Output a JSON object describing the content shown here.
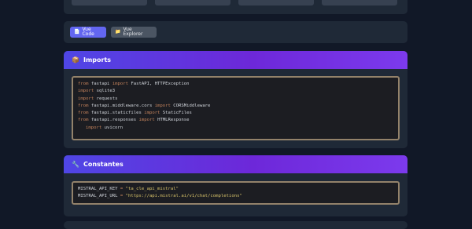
{
  "top_stubs": [
    {
      "label": ""
    },
    {
      "label": ""
    },
    {
      "label": ""
    },
    {
      "label": ""
    }
  ],
  "tabs": [
    {
      "icon": "document-icon",
      "label": "Vue Code",
      "active": true
    },
    {
      "icon": "folder-icon",
      "label": "Vue Explorer",
      "active": false
    }
  ],
  "sections": {
    "imports": {
      "icon": "package-icon",
      "title": "Imports",
      "lines": [
        {
          "kw1": "from",
          "mod": " fastapi ",
          "kw2": "import",
          "rest": " FastAPI, HTTPException"
        },
        {
          "kw1": "import",
          "mod": " sqlite3",
          "kw2": "",
          "rest": ""
        },
        {
          "kw1": "import",
          "mod": " requests",
          "kw2": "",
          "rest": ""
        },
        {
          "kw1": "from",
          "mod": " fastapi.middleware.cors ",
          "kw2": "import",
          "rest": " CORSMiddleware"
        },
        {
          "kw1": "from",
          "mod": " fastapi.staticfiles ",
          "kw2": "import",
          "rest": " StaticFiles"
        },
        {
          "kw1": "from",
          "mod": " fastapi.responses ",
          "kw2": "import",
          "rest": " HTMLResponse"
        },
        {
          "kw1": "import",
          "mod": " uvicorn",
          "kw2": "",
          "rest": ""
        }
      ]
    },
    "constants": {
      "icon": "wrench-icon",
      "title": "Constantes",
      "lines": [
        {
          "name": "MISTRAL_API_KEY ",
          "op": "=",
          "val": " \"ta_cle_api_mistral\""
        },
        {
          "name": "MISTRAL_API_URL ",
          "op": "=",
          "val": " \"https://api.mistral.ai/v1/chat/completions\""
        }
      ]
    }
  }
}
